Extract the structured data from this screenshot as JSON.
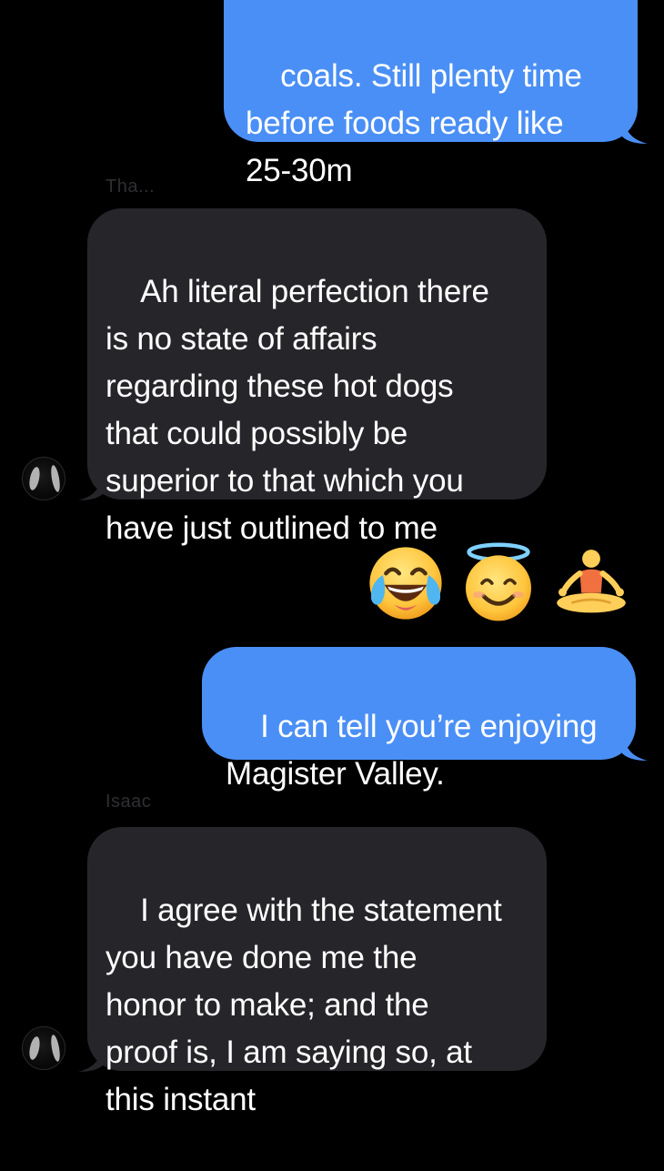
{
  "messages": [
    {
      "direction": "outgoing",
      "text": "coals. Still plenty time\nbefore foods ready like\n25-30m"
    },
    {
      "direction": "incoming",
      "sender_name": "Tha...",
      "text": "Ah literal perfection there\nis no state of affairs\nregarding these hot dogs\nthat could possibly be\nsuperior to that which you\nhave just outlined to me"
    },
    {
      "direction": "outgoing",
      "text": "I can tell you’re enjoying\nMagister Valley."
    },
    {
      "direction": "incoming",
      "sender_name": "Isaac",
      "text": "I agree with the statement\nyou have done me the\nhonor to make; and the\nproof is, I am saying so, at\nthis instant"
    }
  ],
  "emoji_reaction_row": [
    "face-with-tears-of-joy-emoji",
    "smiling-face-with-halo-emoji",
    "person-in-lotus-position-emoji"
  ],
  "colors": {
    "background": "#000000",
    "outgoing_bubble": "#4a8ff5",
    "incoming_bubble": "#26262a",
    "text": "#ffffff",
    "sender_name": "#2f2f33"
  }
}
